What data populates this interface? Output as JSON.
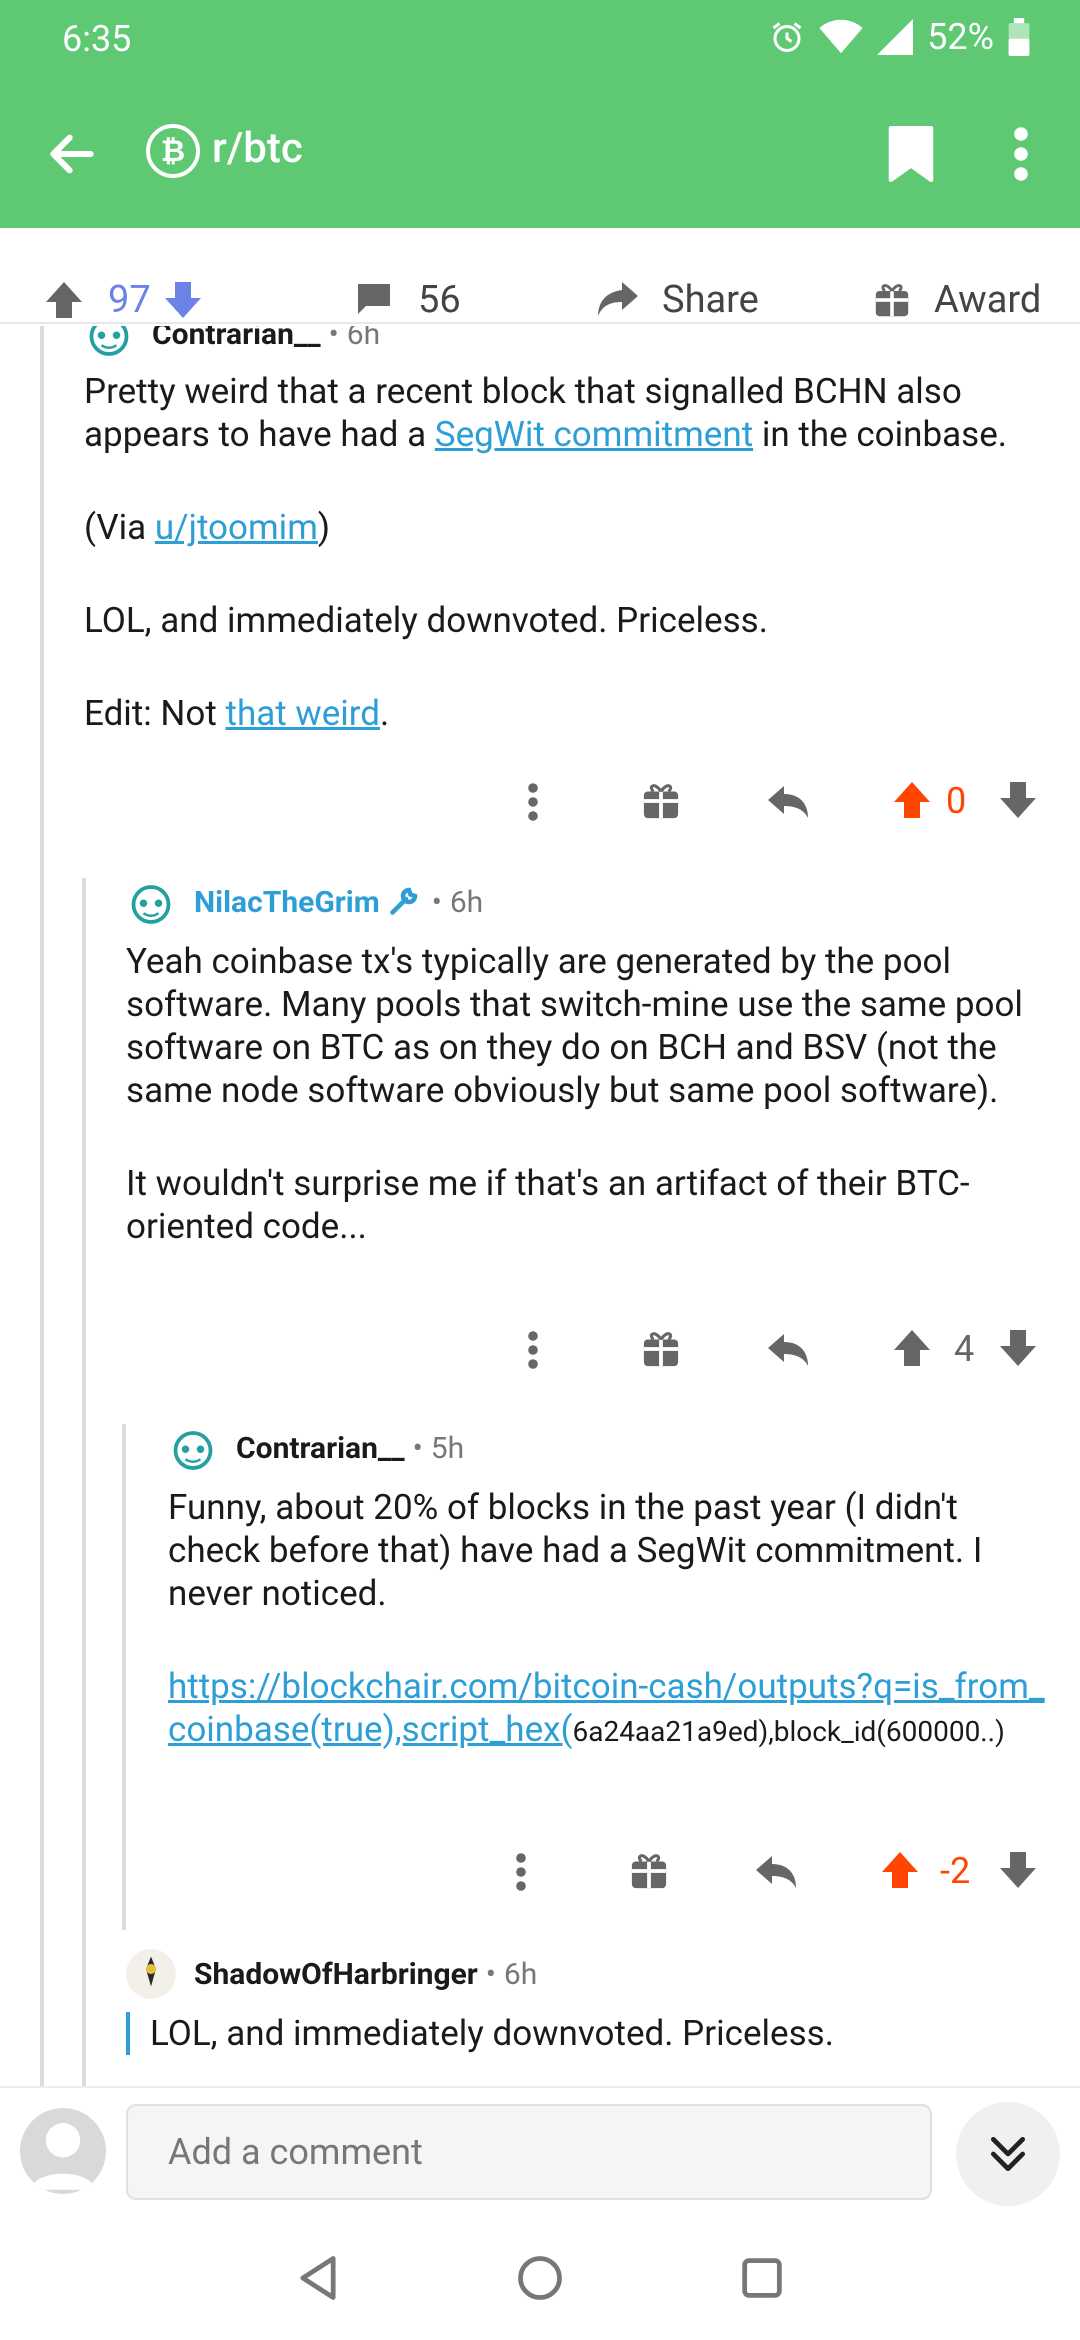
{
  "status": {
    "time": "6:35",
    "battery": "52%"
  },
  "app_bar": {
    "subreddit": "r/btc",
    "sub_icon": "bitcoin-icon"
  },
  "post_actions": {
    "score": "97",
    "comments": "56",
    "share_label": "Share",
    "award_label": "Award"
  },
  "comments": [
    {
      "author": "Contrarian__",
      "time": "6h",
      "paragraphs": [
        [
          {
            "t": "Pretty weird that a recent block that signalled BCHN also appears to have had a "
          },
          {
            "t": "SegWit commitment",
            "link": true
          },
          {
            "t": " in the coinbase."
          }
        ],
        [
          {
            "t": "(Via "
          },
          {
            "t": "u/jtoomim",
            "link": true
          },
          {
            "t": ")"
          }
        ],
        [
          {
            "t": "LOL, and immediately downvoted. Priceless."
          }
        ],
        [
          {
            "t": "Edit: Not "
          },
          {
            "t": "that weird",
            "link": true
          },
          {
            "t": "."
          }
        ]
      ],
      "score": "0",
      "upvoted": true
    },
    {
      "author": "NilacTheGrim",
      "time": "6h",
      "mod": true,
      "paragraphs": [
        [
          {
            "t": "Yeah coinbase tx's typically are generated by the pool software.  Many pools that switch-mine use the same pool software on BTC as on they do on BCH and BSV (not the same node software obviously but same pool software)."
          }
        ],
        [
          {
            "t": "It wouldn't surprise me if that's an artifact of their BTC-oriented code..."
          }
        ]
      ],
      "score": "4",
      "upvoted": false
    },
    {
      "author": "Contrarian__",
      "time": "5h",
      "paragraphs": [
        [
          {
            "t": "Funny, about 20% of blocks in the past year (I didn't check before that) have had a SegWit commitment. I never noticed."
          }
        ],
        [
          {
            "t": "https://blockchair.com/bitcoin-cash/outputs?q=is_from_coinbase(true),script_hex(",
            "link": true
          },
          {
            "t": "6a24aa21a9ed),block_id(600000..)",
            "small": true
          }
        ]
      ],
      "score": "-2",
      "upvoted": true
    },
    {
      "author": "ShadowOfHarbringer",
      "time": "6h",
      "quote": "LOL, and immediately downvoted. Priceless."
    }
  ],
  "bottom": {
    "comment_placeholder": "Add a comment"
  },
  "colors": {
    "accent_green": "#5ec872",
    "upvote_orange": "#ff4500",
    "link_blue": "#2e9ed6"
  }
}
